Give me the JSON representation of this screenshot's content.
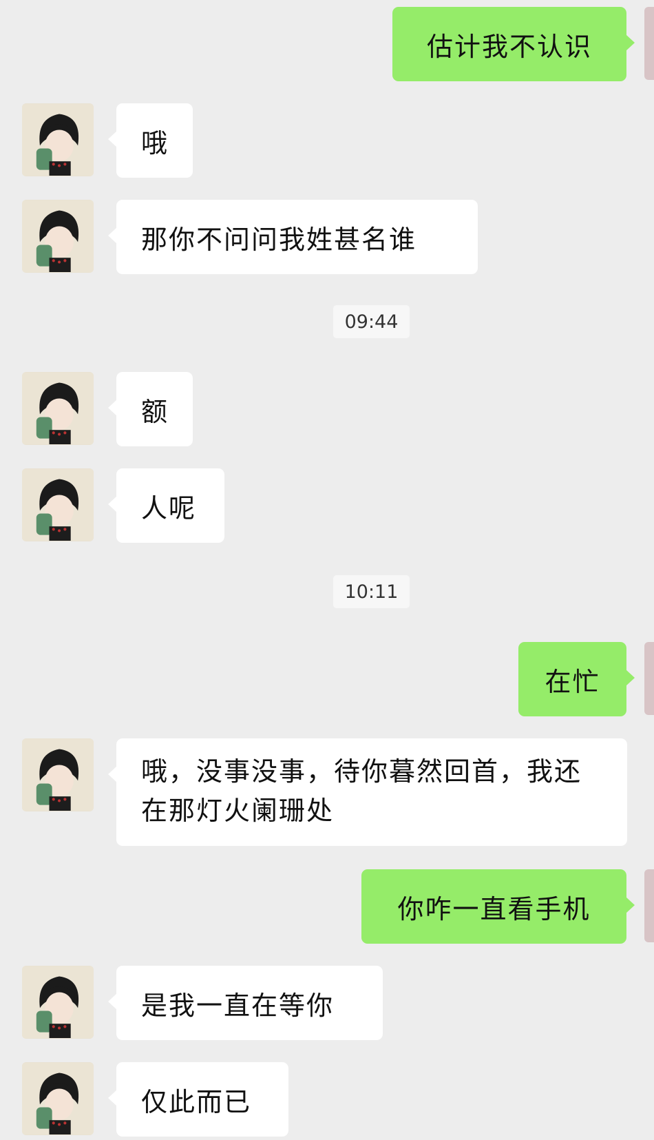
{
  "messages": [
    {
      "from": "me",
      "text": "估计我不认识"
    },
    {
      "from": "them",
      "text": "哦"
    },
    {
      "from": "them",
      "text": "那你不问问我姓甚名谁"
    },
    {
      "timestamp": "09:44"
    },
    {
      "from": "them",
      "text": "额"
    },
    {
      "from": "them",
      "text": "人呢"
    },
    {
      "timestamp": "10:11"
    },
    {
      "from": "me",
      "text": "在忙"
    },
    {
      "from": "them",
      "text": "哦，没事没事，待你暮然回首，我还在那灯火阑珊处"
    },
    {
      "from": "me",
      "text": "你咋一直看手机"
    },
    {
      "from": "them",
      "text": "是我一直在等你"
    },
    {
      "from": "them",
      "text": "仅此而已"
    }
  ],
  "colors": {
    "background": "#ededed",
    "incoming_bubble": "#ffffff",
    "outgoing_bubble": "#95ec69"
  },
  "icons": {
    "contact_avatar": "anime-boy-avatar",
    "self_avatar": "self-avatar"
  }
}
